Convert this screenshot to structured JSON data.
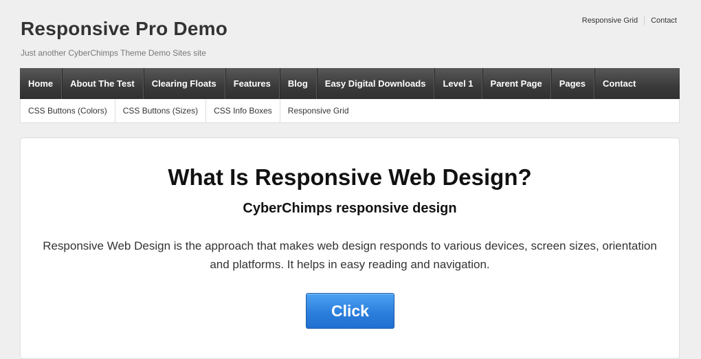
{
  "header": {
    "site_title": "Responsive Pro Demo",
    "site_description": "Just another CyberChimps Theme Demo Sites site",
    "top_menu": [
      "Responsive Grid",
      "Contact"
    ]
  },
  "main_nav": [
    "Home",
    "About The Test",
    "Clearing Floats",
    "Features",
    "Blog",
    "Easy Digital Downloads",
    "Level 1",
    "Parent Page",
    "Pages",
    "Contact"
  ],
  "sub_nav": [
    "CSS Buttons (Colors)",
    "CSS Buttons (Sizes)",
    "CSS Info Boxes",
    "Responsive Grid"
  ],
  "content": {
    "heading": "What Is Responsive Web Design?",
    "subheading": "CyberChimps responsive design",
    "paragraph": "Responsive Web Design is the approach that makes web design responds to various devices, screen sizes, orientation and platforms. It helps in easy reading and navigation.",
    "button_label": "Click"
  },
  "colors": {
    "nav_bg": "#3a3a3a",
    "button_blue": "#2d7fdc",
    "page_bg": "#efefef"
  }
}
